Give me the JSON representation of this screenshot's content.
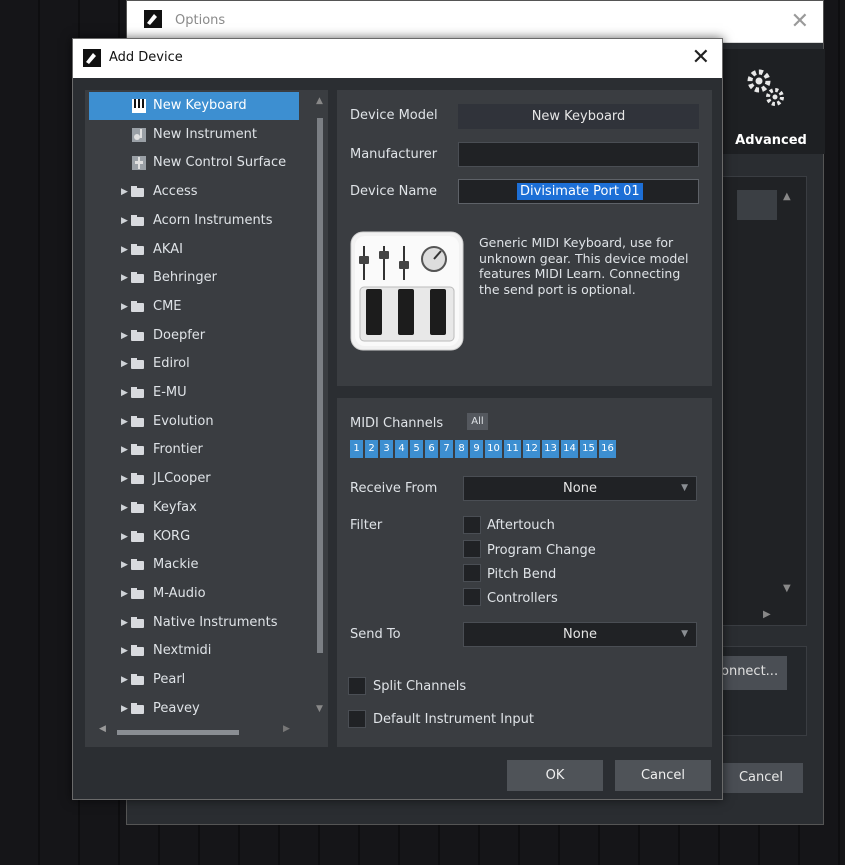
{
  "options_window": {
    "title": "Options",
    "advanced_label": "Advanced",
    "connect_label": "onnect...",
    "cancel_label": "Cancel"
  },
  "dialog": {
    "title": "Add Device",
    "close": "✕"
  },
  "tree": {
    "items": [
      {
        "label": "New Keyboard",
        "icon": "keyboard-icon",
        "selected": true
      },
      {
        "label": "New Instrument",
        "icon": "instrument-icon"
      },
      {
        "label": "New Control Surface",
        "icon": "control-surface-icon"
      },
      {
        "label": "Access",
        "icon": "folder-icon"
      },
      {
        "label": "Acorn Instruments",
        "icon": "folder-icon"
      },
      {
        "label": "AKAI",
        "icon": "folder-icon"
      },
      {
        "label": "Behringer",
        "icon": "folder-icon"
      },
      {
        "label": "CME",
        "icon": "folder-icon"
      },
      {
        "label": "Doepfer",
        "icon": "folder-icon"
      },
      {
        "label": "Edirol",
        "icon": "folder-icon"
      },
      {
        "label": "E-MU",
        "icon": "folder-icon"
      },
      {
        "label": "Evolution",
        "icon": "folder-icon"
      },
      {
        "label": "Frontier",
        "icon": "folder-icon"
      },
      {
        "label": "JLCooper",
        "icon": "folder-icon"
      },
      {
        "label": "Keyfax",
        "icon": "folder-icon"
      },
      {
        "label": "KORG",
        "icon": "folder-icon"
      },
      {
        "label": "Mackie",
        "icon": "folder-icon"
      },
      {
        "label": "M-Audio",
        "icon": "folder-icon"
      },
      {
        "label": "Native Instruments",
        "icon": "folder-icon"
      },
      {
        "label": "Nextmidi",
        "icon": "folder-icon"
      },
      {
        "label": "Pearl",
        "icon": "folder-icon"
      },
      {
        "label": "Peavey",
        "icon": "folder-icon"
      }
    ]
  },
  "device": {
    "model_label": "Device Model",
    "model_value": "New Keyboard",
    "manufacturer_label": "Manufacturer",
    "manufacturer_value": "",
    "name_label": "Device Name",
    "name_value": "Divisimate Port 01",
    "description": "Generic MIDI Keyboard, use for unknown gear. This device model features MIDI Learn. Connecting the send port is optional."
  },
  "midi": {
    "channels_label": "MIDI Channels",
    "all_label": "All",
    "channels": [
      "1",
      "2",
      "3",
      "4",
      "5",
      "6",
      "7",
      "8",
      "9",
      "10",
      "11",
      "12",
      "13",
      "14",
      "15",
      "16"
    ],
    "receive_label": "Receive From",
    "receive_value": "None",
    "filter_label": "Filter",
    "filters": [
      "Aftertouch",
      "Program Change",
      "Pitch Bend",
      "Controllers"
    ],
    "send_label": "Send To",
    "send_value": "None",
    "split_label": "Split Channels",
    "default_input_label": "Default Instrument Input"
  },
  "buttons": {
    "ok": "OK",
    "cancel": "Cancel"
  },
  "colors": {
    "accent": "#3d8fd1",
    "panel": "#3a3d41",
    "dialog_bg": "#2b2e32"
  }
}
